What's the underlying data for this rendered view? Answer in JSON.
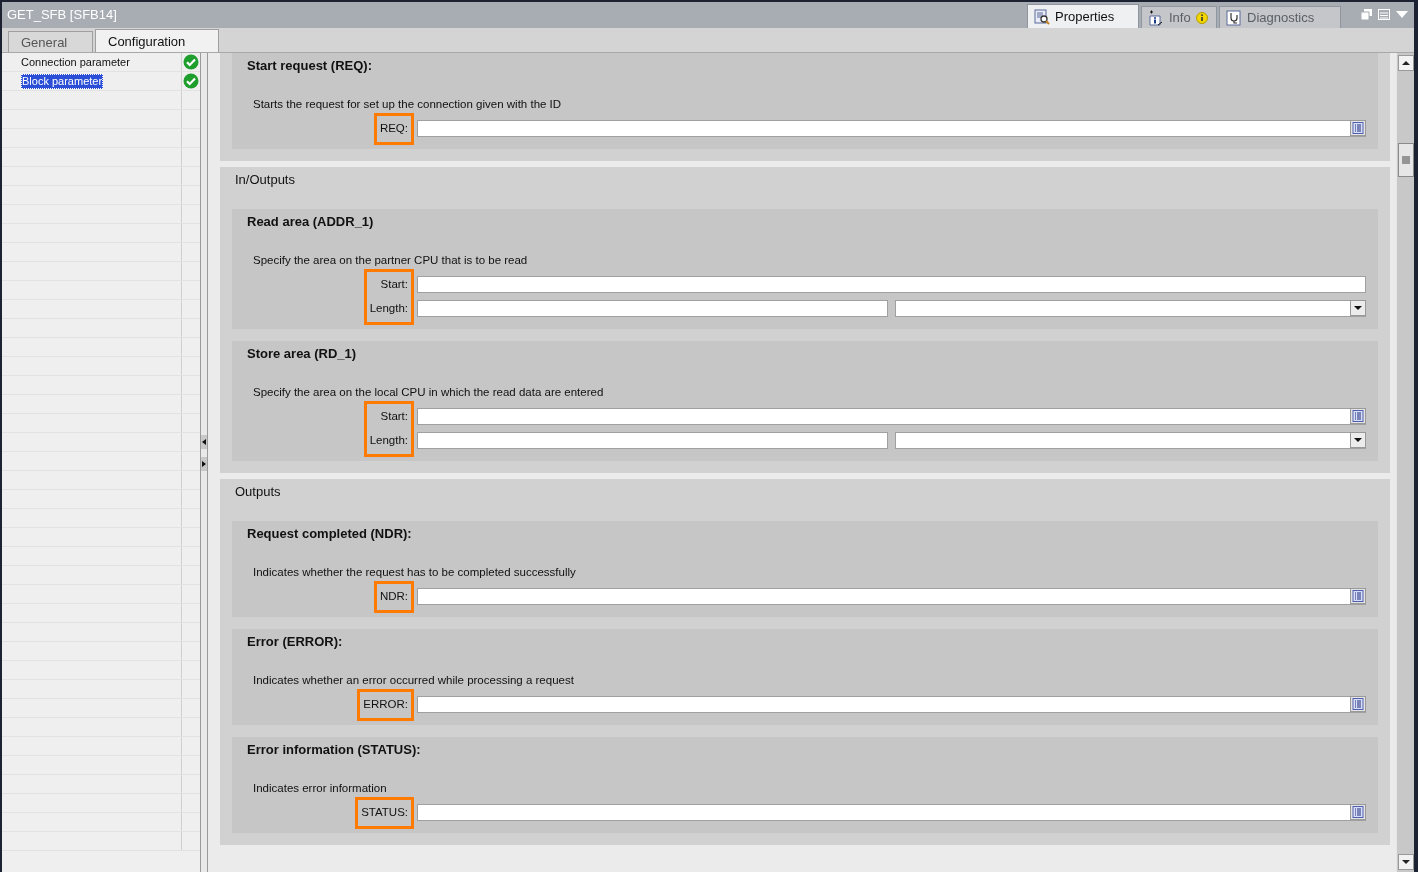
{
  "window": {
    "title": "GET_SFB [SFB14]"
  },
  "inspector_tabs": [
    {
      "label": "Properties",
      "selected": true,
      "kind": "properties"
    },
    {
      "label": "Info",
      "selected": false,
      "kind": "info"
    },
    {
      "label": "Diagnostics",
      "selected": false,
      "kind": "diagnostics"
    }
  ],
  "tabs": [
    {
      "label": "General",
      "selected": false
    },
    {
      "label": "Configuration",
      "selected": true
    }
  ],
  "sidebar": {
    "items": [
      {
        "label": "Connection parameter",
        "selected": false,
        "valid": true
      },
      {
        "label": "Block parameter",
        "selected": true,
        "valid": true
      }
    ]
  },
  "groups": [
    {
      "sections": [
        {
          "title": "Start request (REQ):",
          "description": "Starts the request for set up the connection given with the ID",
          "highlighted": true,
          "fields": [
            {
              "label": "REQ:",
              "kind": "browse"
            }
          ]
        }
      ]
    },
    {
      "title": "In/Outputs",
      "sections": [
        {
          "title": "Read area (ADDR_1)",
          "description": "Specify the area on the partner CPU that is to be read",
          "highlighted": true,
          "fields": [
            {
              "label": "Start:",
              "kind": "text"
            },
            {
              "label": "Length:",
              "kind": "split"
            }
          ]
        },
        {
          "title": "Store area (RD_1)",
          "description": "Specify the area on the local CPU in which the read data are entered",
          "highlighted": true,
          "fields": [
            {
              "label": "Start:",
              "kind": "browse"
            },
            {
              "label": "Length:",
              "kind": "split"
            }
          ]
        }
      ]
    },
    {
      "title": "Outputs",
      "sections": [
        {
          "title": "Request completed (NDR):",
          "description": "Indicates whether the request has to be completed successfully",
          "highlighted": true,
          "fields": [
            {
              "label": "NDR:",
              "kind": "browse"
            }
          ]
        },
        {
          "title": "Error (ERROR):",
          "description": "Indicates whether an error occurred while processing a request",
          "highlighted": true,
          "fields": [
            {
              "label": "ERROR:",
              "kind": "browse"
            }
          ]
        },
        {
          "title": "Error information (STATUS):",
          "description": "Indicates error information",
          "highlighted": true,
          "fields": [
            {
              "label": "STATUS:",
              "kind": "browse"
            }
          ]
        }
      ]
    }
  ]
}
